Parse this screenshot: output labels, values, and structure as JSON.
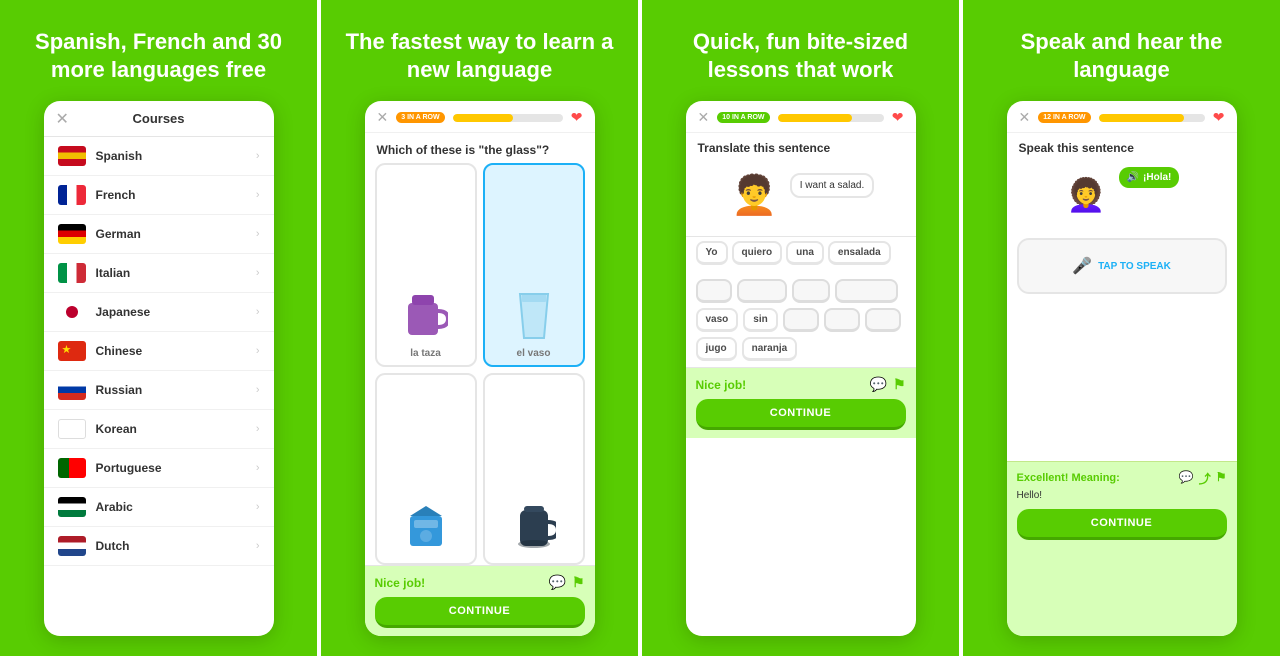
{
  "panels": [
    {
      "id": "panel1",
      "title": "Spanish, French and 30 more languages free",
      "phone": {
        "header": "Courses",
        "courses": [
          {
            "name": "Spanish",
            "flag": "es"
          },
          {
            "name": "French",
            "flag": "fr"
          },
          {
            "name": "German",
            "flag": "de"
          },
          {
            "name": "Italian",
            "flag": "it"
          },
          {
            "name": "Japanese",
            "flag": "ja"
          },
          {
            "name": "Chinese",
            "flag": "cn"
          },
          {
            "name": "Russian",
            "flag": "ru"
          },
          {
            "name": "Korean",
            "flag": "ko"
          },
          {
            "name": "Portuguese",
            "flag": "pt"
          },
          {
            "name": "Arabic",
            "flag": "ar"
          },
          {
            "name": "Dutch",
            "flag": "nl"
          }
        ]
      }
    },
    {
      "id": "panel2",
      "title": "The fastest way to learn a new language",
      "phone": {
        "streak": "3 IN A ROW",
        "progress": 55,
        "hearts": "♥",
        "question": "Which of these is \"the glass\"?",
        "options": [
          {
            "label": "la taza",
            "selected": false
          },
          {
            "label": "el vaso",
            "selected": true
          },
          {
            "label": "",
            "selected": false
          },
          {
            "label": "",
            "selected": false
          }
        ],
        "nicejob": "Nice job!",
        "continue": "CONTINUE"
      }
    },
    {
      "id": "panel3",
      "title": "Quick, fun bite-sized lessons that work",
      "phone": {
        "streak": "10 IN A ROW",
        "progress": 70,
        "title": "Translate this sentence",
        "bubble": "I want a salad.",
        "word_bank": [
          "Yo",
          "quiero",
          "una",
          "ensalada",
          "vaso",
          "sin",
          "jugo",
          "naranja"
        ],
        "empty_slots": 3,
        "nicejob": "Nice job!",
        "continue": "CONTINUE"
      }
    },
    {
      "id": "panel4",
      "title": "Speak and hear the language",
      "phone": {
        "streak": "12 IN A ROW",
        "progress": 80,
        "title": "Speak this sentence",
        "bubble": "¡Hola!",
        "tap_label": "TAP TO SPEAK",
        "excellent": "Excellent! Meaning:",
        "meaning": "Hello!",
        "continue": "CONTINUE"
      }
    }
  ],
  "icons": {
    "close": "✕",
    "chevron": "›",
    "heart": "❤",
    "mic": "🎤",
    "bubble": "💬",
    "share": "⤴",
    "flag_report": "⚑",
    "sound": "🔊"
  }
}
